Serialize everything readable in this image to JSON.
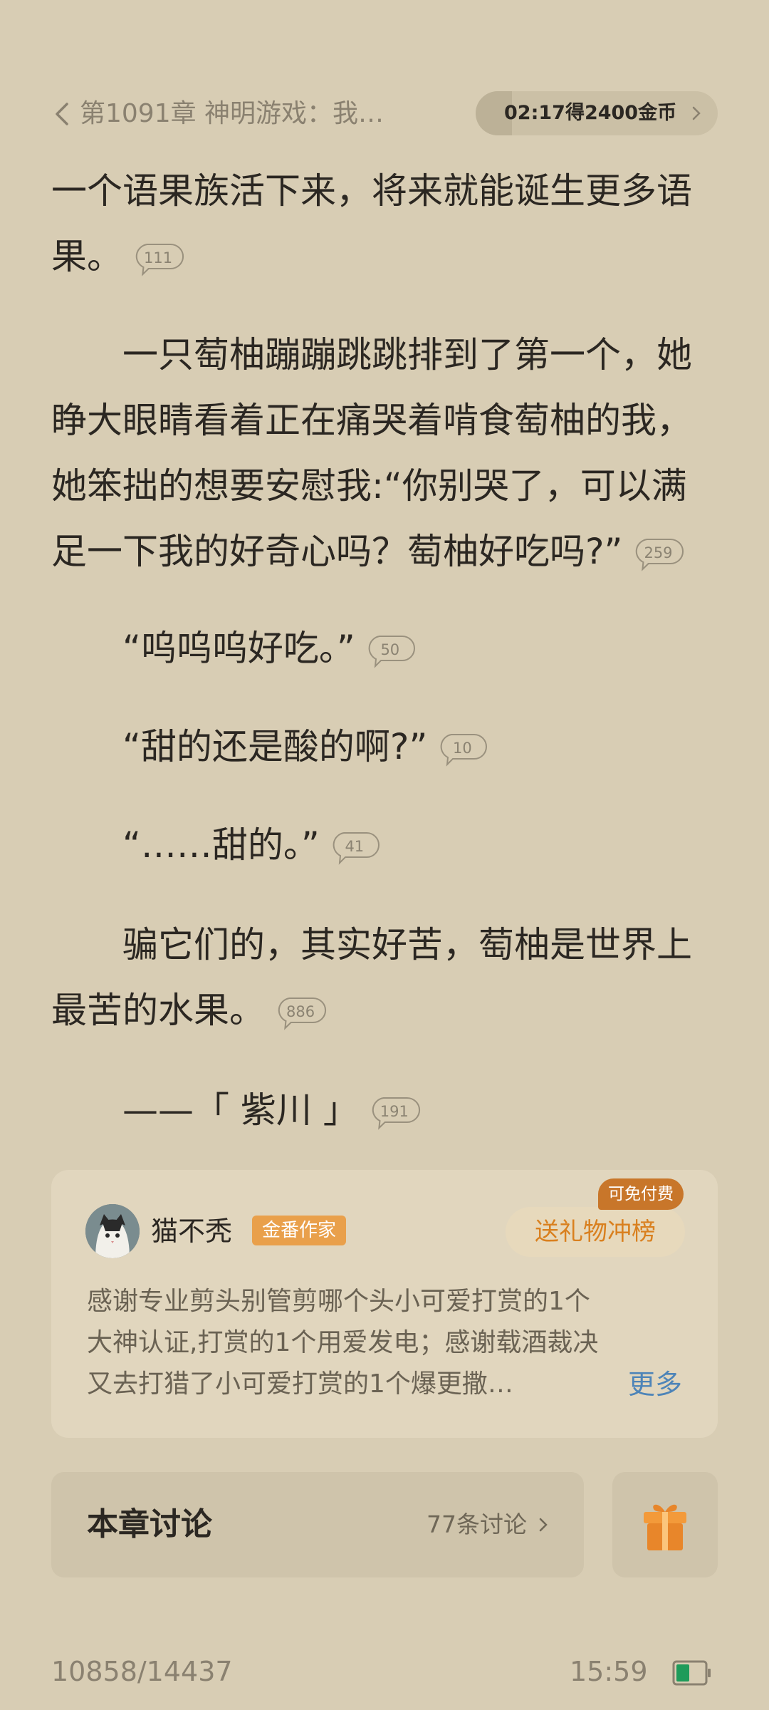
{
  "header": {
    "chapter_title": "第1091章 神明游戏：我…",
    "reward_text": "02:17得2400金币",
    "reward_progress": 0.15
  },
  "content": {
    "p1_line1": "一个语果族活下来，将来就能诞生更多语",
    "p1_line2": "果。",
    "p1_count": "111",
    "p2_line1": "　　一只萄柚蹦蹦跳跳排到了第一个，她",
    "p2_line2": "睁大眼睛看着正在痛哭着啃食萄柚的我，",
    "p2_line3": "她笨拙的想要安慰我:“你别哭了，可以满",
    "p2_line4": "足一下我的好奇心吗？萄柚好吃吗?”",
    "p2_count": "259",
    "p3": "　　“呜呜呜好吃。”",
    "p3_count": "50",
    "p4": "　　“甜的还是酸的啊?”",
    "p4_count": "10",
    "p5": "　　“……甜的。”",
    "p5_count": "41",
    "p6_line1": "　　骗它们的，其实好苦，萄柚是世界上",
    "p6_line2": "最苦的水果。",
    "p6_count": "886",
    "p7": "　　——「 紫川 」",
    "p7_count": "191"
  },
  "author_card": {
    "name": "猫不秃",
    "badge": "金番作家",
    "gift_button": "送礼物冲榜",
    "free_tag": "可免付费",
    "thanks_line1": "感谢专业剪头别管剪哪个头小可爱打赏的1个",
    "thanks_line2": "大神认证,打赏的1个用爱发电；感谢载酒裁决",
    "thanks_line3": "又去打猎了小可爱打赏的1个爆更撒…",
    "more": "更多"
  },
  "discussion": {
    "title": "本章讨论",
    "count": "77条讨论"
  },
  "footer": {
    "progress": "10858/14437",
    "time": "15:59"
  },
  "colors": {
    "background": "#d8cdb4",
    "accent_orange": "#d9801f",
    "link_blue": "#4d84b8"
  },
  "icons": [
    "back-chevron-icon",
    "chevron-right-icon",
    "comment-bubble-icon",
    "gift-box-icon",
    "battery-icon"
  ]
}
